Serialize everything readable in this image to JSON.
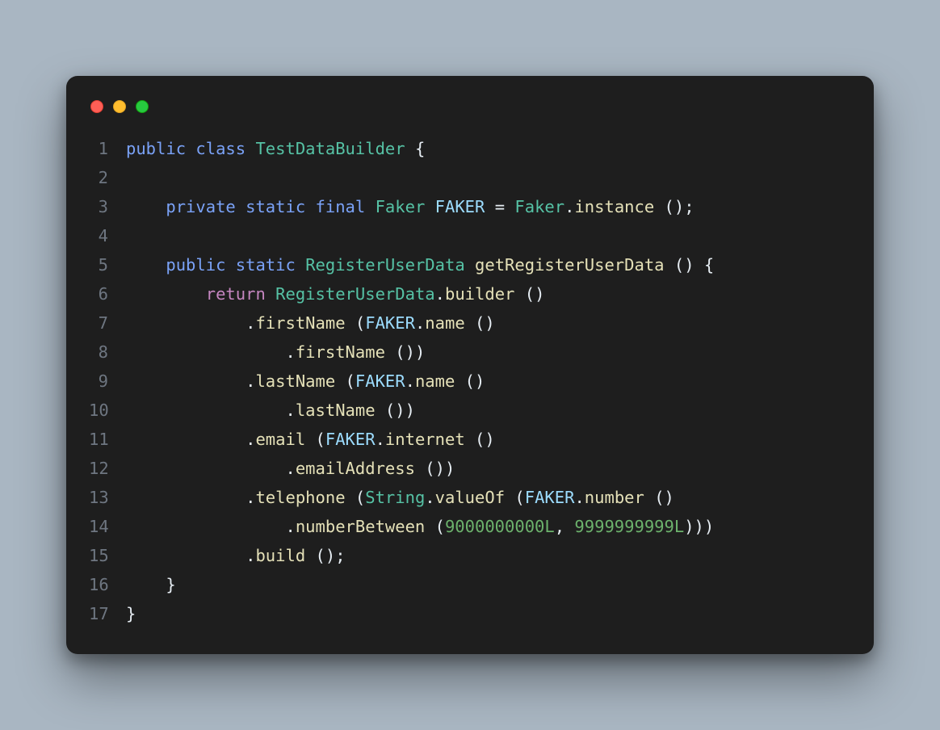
{
  "lines": [
    {
      "n": "1",
      "segs": [
        {
          "c": "kw",
          "t": "public"
        },
        {
          "c": "pun",
          "t": " "
        },
        {
          "c": "kw",
          "t": "class"
        },
        {
          "c": "pun",
          "t": " "
        },
        {
          "c": "type",
          "t": "TestDataBuilder"
        },
        {
          "c": "pun",
          "t": " {"
        }
      ]
    },
    {
      "n": "2",
      "segs": [
        {
          "c": "pun",
          "t": ""
        }
      ]
    },
    {
      "n": "3",
      "segs": [
        {
          "c": "pun",
          "t": "    "
        },
        {
          "c": "kw",
          "t": "private"
        },
        {
          "c": "pun",
          "t": " "
        },
        {
          "c": "kw",
          "t": "static"
        },
        {
          "c": "pun",
          "t": " "
        },
        {
          "c": "kw",
          "t": "final"
        },
        {
          "c": "pun",
          "t": " "
        },
        {
          "c": "type",
          "t": "Faker"
        },
        {
          "c": "pun",
          "t": " "
        },
        {
          "c": "var",
          "t": "FAKER"
        },
        {
          "c": "pun",
          "t": " = "
        },
        {
          "c": "type",
          "t": "Faker"
        },
        {
          "c": "pun",
          "t": "."
        },
        {
          "c": "func",
          "t": "instance"
        },
        {
          "c": "pun",
          "t": " ();"
        }
      ]
    },
    {
      "n": "4",
      "segs": [
        {
          "c": "pun",
          "t": ""
        }
      ]
    },
    {
      "n": "5",
      "segs": [
        {
          "c": "pun",
          "t": "    "
        },
        {
          "c": "kw",
          "t": "public"
        },
        {
          "c": "pun",
          "t": " "
        },
        {
          "c": "kw",
          "t": "static"
        },
        {
          "c": "pun",
          "t": " "
        },
        {
          "c": "type",
          "t": "RegisterUserData"
        },
        {
          "c": "pun",
          "t": " "
        },
        {
          "c": "func",
          "t": "getRegisterUserData"
        },
        {
          "c": "pun",
          "t": " () {"
        }
      ]
    },
    {
      "n": "6",
      "segs": [
        {
          "c": "pun",
          "t": "        "
        },
        {
          "c": "mret",
          "t": "return"
        },
        {
          "c": "pun",
          "t": " "
        },
        {
          "c": "type",
          "t": "RegisterUserData"
        },
        {
          "c": "pun",
          "t": "."
        },
        {
          "c": "func",
          "t": "builder"
        },
        {
          "c": "pun",
          "t": " ()"
        }
      ]
    },
    {
      "n": "7",
      "segs": [
        {
          "c": "pun",
          "t": "            ."
        },
        {
          "c": "func",
          "t": "firstName"
        },
        {
          "c": "pun",
          "t": " ("
        },
        {
          "c": "var",
          "t": "FAKER"
        },
        {
          "c": "pun",
          "t": "."
        },
        {
          "c": "func",
          "t": "name"
        },
        {
          "c": "pun",
          "t": " ()"
        }
      ]
    },
    {
      "n": "8",
      "segs": [
        {
          "c": "pun",
          "t": "                ."
        },
        {
          "c": "func",
          "t": "firstName"
        },
        {
          "c": "pun",
          "t": " ())"
        }
      ]
    },
    {
      "n": "9",
      "segs": [
        {
          "c": "pun",
          "t": "            ."
        },
        {
          "c": "func",
          "t": "lastName"
        },
        {
          "c": "pun",
          "t": " ("
        },
        {
          "c": "var",
          "t": "FAKER"
        },
        {
          "c": "pun",
          "t": "."
        },
        {
          "c": "func",
          "t": "name"
        },
        {
          "c": "pun",
          "t": " ()"
        }
      ]
    },
    {
      "n": "10",
      "segs": [
        {
          "c": "pun",
          "t": "                ."
        },
        {
          "c": "func",
          "t": "lastName"
        },
        {
          "c": "pun",
          "t": " ())"
        }
      ]
    },
    {
      "n": "11",
      "segs": [
        {
          "c": "pun",
          "t": "            ."
        },
        {
          "c": "func",
          "t": "email"
        },
        {
          "c": "pun",
          "t": " ("
        },
        {
          "c": "var",
          "t": "FAKER"
        },
        {
          "c": "pun",
          "t": "."
        },
        {
          "c": "func",
          "t": "internet"
        },
        {
          "c": "pun",
          "t": " ()"
        }
      ]
    },
    {
      "n": "12",
      "segs": [
        {
          "c": "pun",
          "t": "                ."
        },
        {
          "c": "func",
          "t": "emailAddress"
        },
        {
          "c": "pun",
          "t": " ())"
        }
      ]
    },
    {
      "n": "13",
      "segs": [
        {
          "c": "pun",
          "t": "            ."
        },
        {
          "c": "func",
          "t": "telephone"
        },
        {
          "c": "pun",
          "t": " ("
        },
        {
          "c": "type",
          "t": "String"
        },
        {
          "c": "pun",
          "t": "."
        },
        {
          "c": "func",
          "t": "valueOf"
        },
        {
          "c": "pun",
          "t": " ("
        },
        {
          "c": "var",
          "t": "FAKER"
        },
        {
          "c": "pun",
          "t": "."
        },
        {
          "c": "func",
          "t": "number"
        },
        {
          "c": "pun",
          "t": " ()"
        }
      ]
    },
    {
      "n": "14",
      "segs": [
        {
          "c": "pun",
          "t": "                ."
        },
        {
          "c": "func",
          "t": "numberBetween"
        },
        {
          "c": "pun",
          "t": " ("
        },
        {
          "c": "num",
          "t": "9000000000L"
        },
        {
          "c": "pun",
          "t": ", "
        },
        {
          "c": "num",
          "t": "9999999999L"
        },
        {
          "c": "pun",
          "t": ")))"
        }
      ]
    },
    {
      "n": "15",
      "segs": [
        {
          "c": "pun",
          "t": "            ."
        },
        {
          "c": "func",
          "t": "build"
        },
        {
          "c": "pun",
          "t": " ();"
        }
      ]
    },
    {
      "n": "16",
      "segs": [
        {
          "c": "pun",
          "t": "    }"
        }
      ]
    },
    {
      "n": "17",
      "segs": [
        {
          "c": "pun",
          "t": "}"
        }
      ]
    }
  ]
}
